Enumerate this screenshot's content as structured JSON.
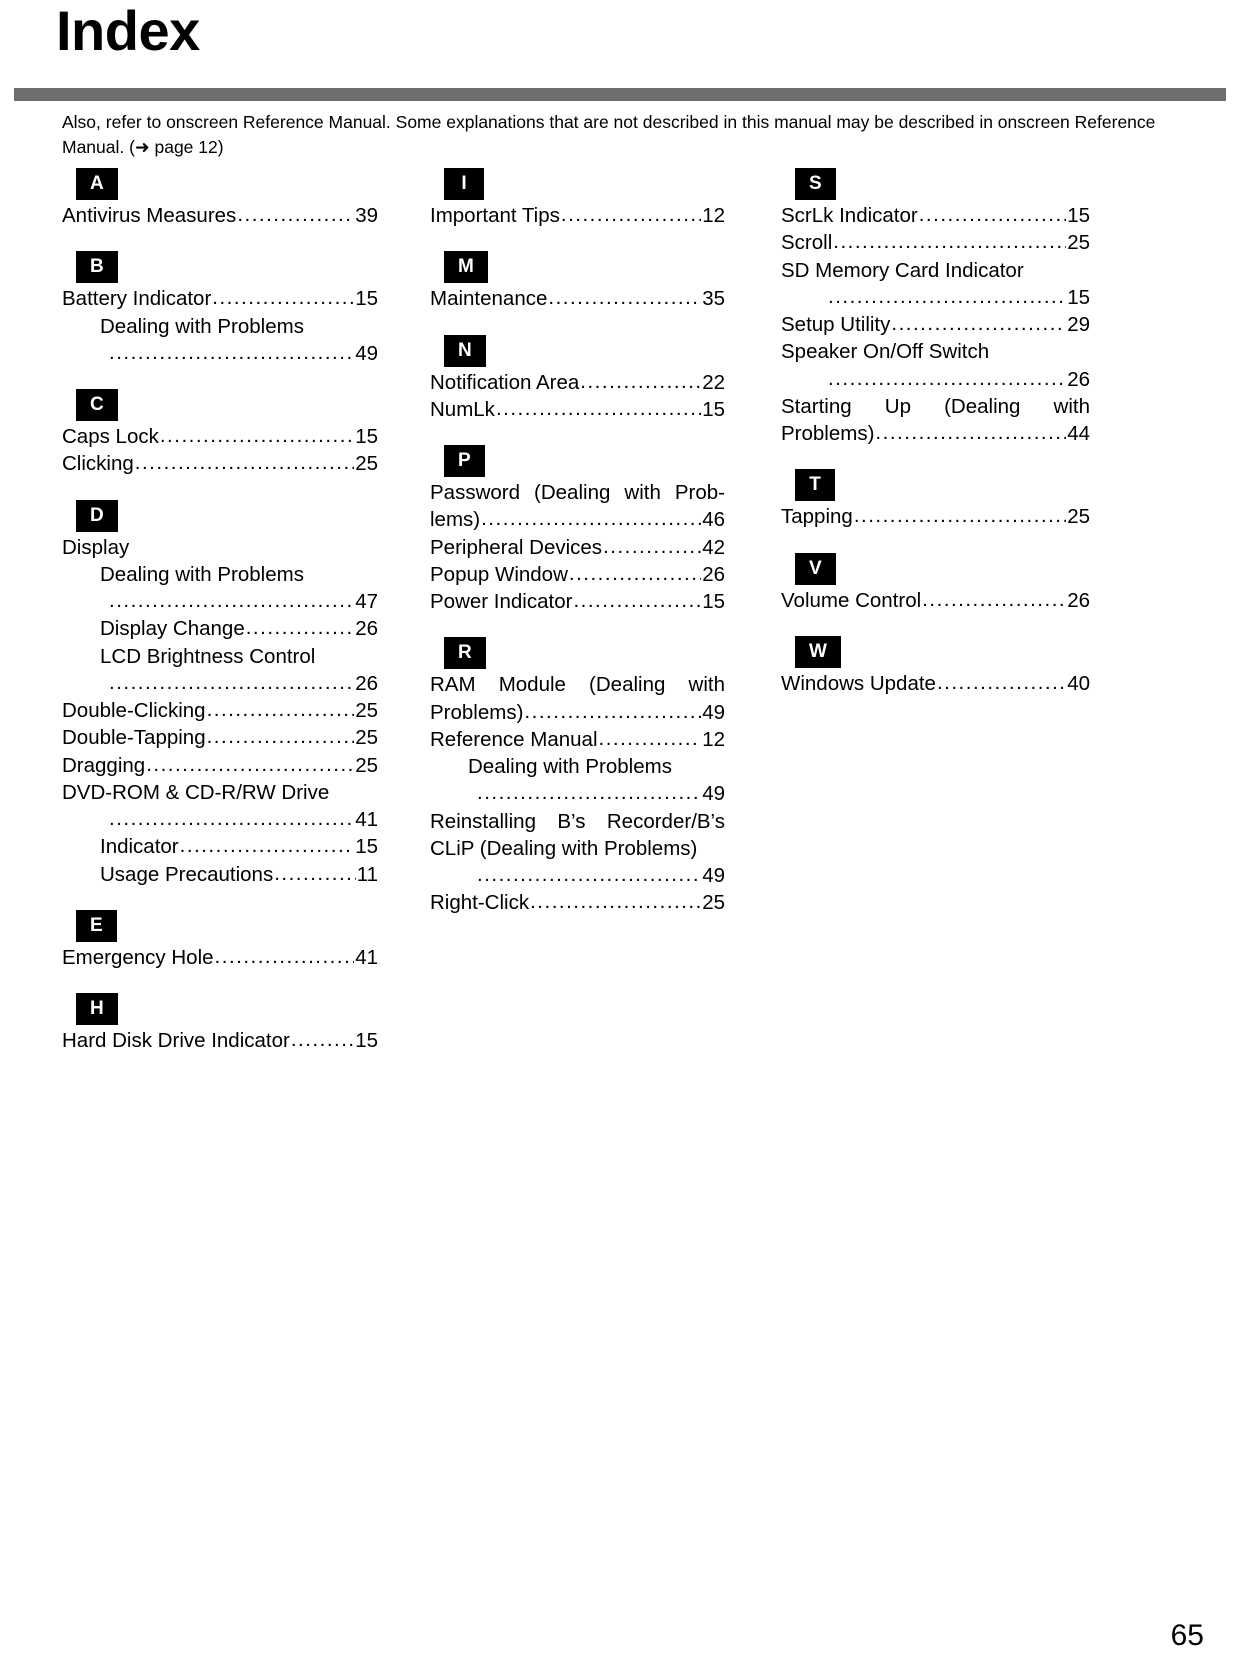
{
  "header": {
    "title": "Index",
    "intro": "Also, refer to onscreen Reference Manual. Some explanations that are not described in this manual may be described in onscreen Reference Manual. (➜ page 12)"
  },
  "footer": {
    "page_number": "65"
  },
  "columns": [
    {
      "id": "column-1",
      "sections": [
        {
          "letter": "A",
          "entries": [
            {
              "label": "Antivirus Measures",
              "page": "39",
              "indent": 0,
              "wrap": false
            }
          ]
        },
        {
          "letter": "B",
          "entries": [
            {
              "label": "Battery Indicator",
              "page": "15",
              "indent": 0,
              "wrap": false
            },
            {
              "label": "Dealing with Problems",
              "page": "49",
              "indent": 1,
              "wrap": true
            }
          ]
        },
        {
          "letter": "C",
          "entries": [
            {
              "label": "Caps Lock",
              "page": "15",
              "indent": 0,
              "wrap": false
            },
            {
              "label": "Clicking",
              "page": "25",
              "indent": 0,
              "wrap": false
            }
          ]
        },
        {
          "letter": "D",
          "entries": [
            {
              "label": "Display",
              "page": "",
              "indent": 0,
              "wrap": false
            },
            {
              "label": "Dealing with Problems",
              "page": "47",
              "indent": 1,
              "wrap": true
            },
            {
              "label": "Display Change",
              "page": "26",
              "indent": 1,
              "wrap": false
            },
            {
              "label": "LCD Brightness Control",
              "page": "26",
              "indent": 1,
              "wrap": true
            },
            {
              "label": "Double-Clicking",
              "page": "25",
              "indent": 0,
              "wrap": false
            },
            {
              "label": "Double-Tapping",
              "page": "25",
              "indent": 0,
              "wrap": false
            },
            {
              "label": "Dragging",
              "page": "25",
              "indent": 0,
              "wrap": false
            },
            {
              "label": "DVD-ROM & CD-R/RW Drive",
              "page": "41",
              "indent": 0,
              "wrap": true
            },
            {
              "label": "Indicator",
              "page": "15",
              "indent": 1,
              "wrap": false
            },
            {
              "label": "Usage Precautions",
              "page": "11",
              "indent": 1,
              "wrap": false
            }
          ]
        },
        {
          "letter": "E",
          "entries": [
            {
              "label": "Emergency Hole",
              "page": "41",
              "indent": 0,
              "wrap": false
            }
          ]
        },
        {
          "letter": "H",
          "entries": [
            {
              "label": "Hard Disk Drive Indicator",
              "page": "15",
              "indent": 0,
              "wrap": false
            }
          ]
        }
      ]
    },
    {
      "id": "column-2",
      "sections": [
        {
          "letter": "I",
          "entries": [
            {
              "label": "Important Tips",
              "page": "12",
              "indent": 0,
              "wrap": false
            }
          ]
        },
        {
          "letter": "M",
          "entries": [
            {
              "label": "Maintenance",
              "page": "35",
              "indent": 0,
              "wrap": false
            }
          ]
        },
        {
          "letter": "N",
          "entries": [
            {
              "label": "Notification Area",
              "page": "22",
              "indent": 0,
              "wrap": false
            },
            {
              "label": "NumLk",
              "page": "15",
              "indent": 0,
              "wrap": false
            }
          ]
        },
        {
          "letter": "P",
          "entries": [
            {
              "label": "Password (Dealing with Prob-",
              "label2": "lems)",
              "page": "46",
              "indent": 0,
              "wrap": false,
              "justify": true
            },
            {
              "label": "Peripheral Devices",
              "page": "42",
              "indent": 0,
              "wrap": false
            },
            {
              "label": "Popup Window",
              "page": "26",
              "indent": 0,
              "wrap": false
            },
            {
              "label": "Power Indicator",
              "page": "15",
              "indent": 0,
              "wrap": false
            }
          ]
        },
        {
          "letter": "R",
          "entries": [
            {
              "label": "RAM Module (Dealing with",
              "label2": "Problems)",
              "page": "49",
              "indent": 0,
              "wrap": false,
              "justify": true
            },
            {
              "label": "Reference Manual",
              "page": "12",
              "indent": 0,
              "wrap": false
            },
            {
              "label": "Dealing with Problems",
              "page": "49",
              "indent": 1,
              "wrap": true
            },
            {
              "label": "Reinstalling B’s Recorder/B’s",
              "label2": "CLiP (Dealing with Problems)",
              "page": "49",
              "indent": 0,
              "wrap": true,
              "justify": true
            },
            {
              "label": "Right-Click",
              "page": "25",
              "indent": 0,
              "wrap": false
            }
          ]
        }
      ]
    },
    {
      "id": "column-3",
      "sections": [
        {
          "letter": "S",
          "entries": [
            {
              "label": "ScrLk Indicator",
              "page": "15",
              "indent": 0,
              "wrap": false
            },
            {
              "label": "Scroll",
              "page": "25",
              "indent": 0,
              "wrap": false
            },
            {
              "label": "SD Memory Card Indicator",
              "page": "15",
              "indent": 0,
              "wrap": true
            },
            {
              "label": "Setup Utility",
              "page": "29",
              "indent": 0,
              "wrap": false
            },
            {
              "label": "Speaker On/Off Switch",
              "page": "26",
              "indent": 0,
              "wrap": true
            },
            {
              "label": "Starting Up (Dealing with",
              "label2": "Problems)",
              "page": "44",
              "indent": 0,
              "wrap": false,
              "justify": true
            }
          ]
        },
        {
          "letter": "T",
          "entries": [
            {
              "label": "Tapping",
              "page": "25",
              "indent": 0,
              "wrap": false
            }
          ]
        },
        {
          "letter": "V",
          "entries": [
            {
              "label": "Volume Control",
              "page": "26",
              "indent": 0,
              "wrap": false
            }
          ]
        },
        {
          "letter": "W",
          "entries": [
            {
              "label": "Windows Update",
              "page": "40",
              "indent": 0,
              "wrap": false
            }
          ]
        }
      ]
    }
  ]
}
